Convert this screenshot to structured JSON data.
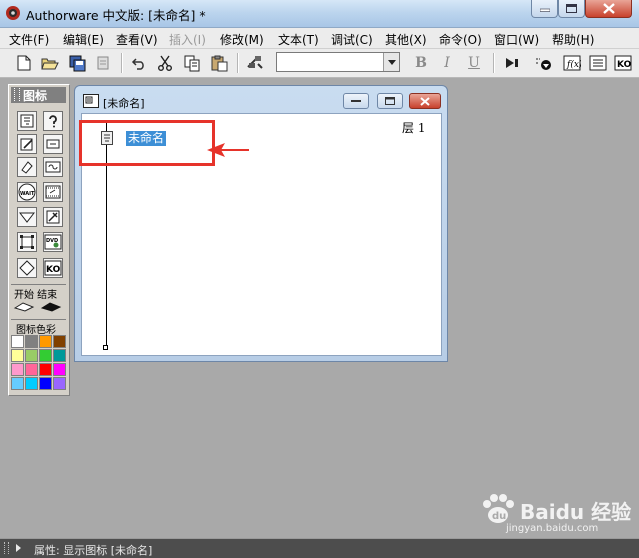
{
  "window": {
    "title": "Authorware 中文版: [未命名] *"
  },
  "menu": {
    "items": [
      {
        "label": "文件(F)",
        "enabled": true
      },
      {
        "label": "编辑(E)",
        "enabled": true
      },
      {
        "label": "查看(V)",
        "enabled": true
      },
      {
        "label": "插入(I)",
        "enabled": false
      },
      {
        "label": "修改(M)",
        "enabled": true
      },
      {
        "label": "文本(T)",
        "enabled": true
      },
      {
        "label": "调试(C)",
        "enabled": true
      },
      {
        "label": "其他(X)",
        "enabled": true
      },
      {
        "label": "命令(O)",
        "enabled": true
      },
      {
        "label": "窗口(W)",
        "enabled": true
      },
      {
        "label": "帮助(H)",
        "enabled": true
      }
    ]
  },
  "toolbar": {
    "icons": [
      "new-file-icon",
      "open-file-icon",
      "save-all-icon",
      "import-icon",
      "undo-icon",
      "cut-icon",
      "copy-icon",
      "paste-icon",
      "find-icon",
      "run-icon",
      "control-panel-icon",
      "function-icon",
      "variable-icon",
      "knowledge-object-icon"
    ],
    "font_combo_value": "",
    "bold_label": "B",
    "italic_label": "I",
    "underline_label": "U"
  },
  "palette": {
    "title": "图标",
    "icons": [
      "display-icon",
      "motion-icon",
      "erase-icon",
      "wait-icon",
      "navigate-icon",
      "framework-icon",
      "decision-icon",
      "interaction-icon",
      "calculation-icon",
      "map-icon",
      "digital-movie-icon",
      "sound-icon",
      "dvd-video-icon",
      "knowledge-object-icon"
    ],
    "start_end_label": "开始  结束",
    "color_label": "图标色彩",
    "colors": [
      "#ffffff",
      "#808080",
      "#ff9900",
      "#804000",
      "#ffff99",
      "#99cc66",
      "#33cc33",
      "#009999",
      "#ff99cc",
      "#ff6699",
      "#ff0000",
      "#ff00ff",
      "#66ccff",
      "#00ccff",
      "#0000ff",
      "#9966ff"
    ],
    "wait_label": "WAIT",
    "dvd_label": "DVD",
    "ko_label": "KO"
  },
  "document": {
    "title": "[未命名]",
    "layer_label": "层 1",
    "flowline": {
      "icon_name": "未命名"
    }
  },
  "annotation": {
    "highlight_color": "#e6332a"
  },
  "status": {
    "text": "属性: 显示图标 [未命名]"
  },
  "watermark": {
    "brand": "Baidu 经验",
    "url": "jingyan.baidu.com"
  }
}
